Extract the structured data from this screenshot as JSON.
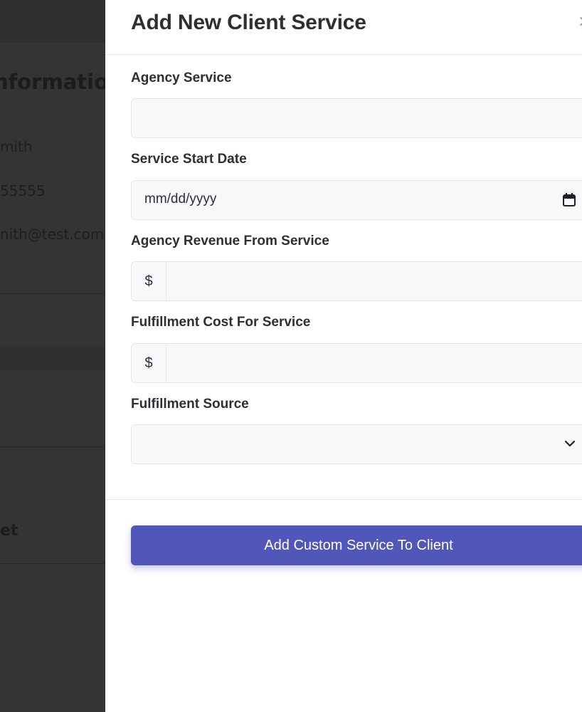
{
  "backdrop": {
    "heading": "Informatio",
    "lines": [
      "mith",
      "55555",
      "nith@test.com"
    ],
    "heading2": "et"
  },
  "modal": {
    "title": "Add New Client Service",
    "close_icon": "close-icon",
    "fields": {
      "agency_service": {
        "label": "Agency Service",
        "value": ""
      },
      "start_date": {
        "label": "Service Start Date",
        "value": "mm/dd/yyyy"
      },
      "revenue": {
        "label": "Agency Revenue From Service",
        "prefix": "$",
        "value": ""
      },
      "cost": {
        "label": "Fulfillment Cost For Service",
        "prefix": "$",
        "value": ""
      },
      "source": {
        "label": "Fulfillment Source",
        "value": ""
      }
    },
    "submit_label": "Add Custom Service To Client"
  },
  "colors": {
    "accent": "#5157b8",
    "input_bg": "#f7f8fa",
    "backdrop": "#343434"
  }
}
